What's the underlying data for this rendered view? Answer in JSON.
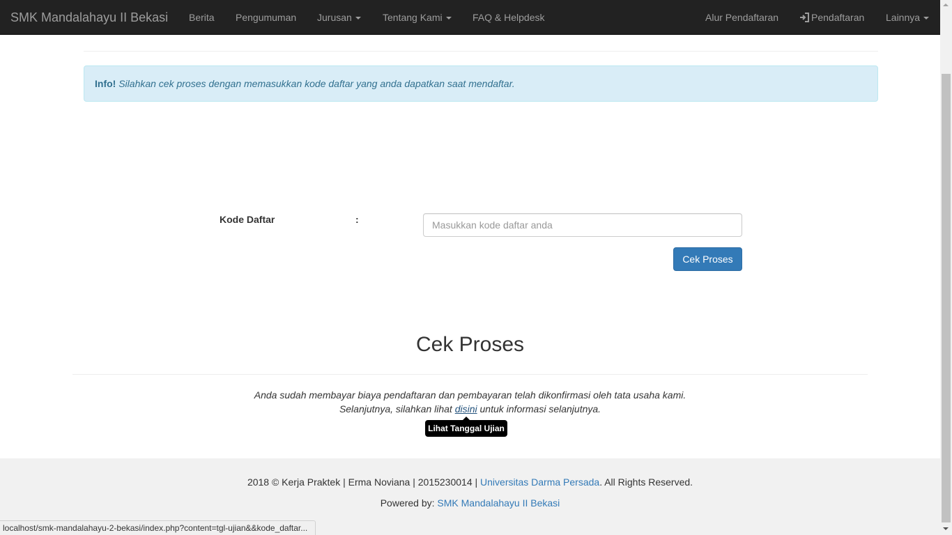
{
  "navbar": {
    "brand": "SMK Mandalahayu II Bekasi",
    "items": [
      {
        "label": "Berita"
      },
      {
        "label": "Pengumuman"
      },
      {
        "label": "Jurusan"
      },
      {
        "label": "Tentang Kami"
      },
      {
        "label": "FAQ & Helpdesk"
      }
    ],
    "right_items": [
      {
        "label": "Alur Pendaftaran"
      },
      {
        "label": "Pendaftaran",
        "icon": "login-icon"
      },
      {
        "label": "Lainnya"
      }
    ]
  },
  "alert": {
    "title": "Info!",
    "text": "Silahkan cek proses dengan memasukkan kode daftar yang anda dapatkan saat mendaftar."
  },
  "form": {
    "label": "Kode Daftar",
    "colon": ":",
    "placeholder": "Masukkan kode daftar anda",
    "value": "",
    "submit_label": "Cek Proses"
  },
  "result": {
    "title": "Cek Proses",
    "line1": "Anda sudah membayar biaya pendaftaran dan pembayaran telah dikonfirmasi oleh tata usaha kami.",
    "line2_before": "Selanjutnya, silahkan lihat ",
    "line2_link": "disini",
    "line2_after": " untuk informasi selanjutnya.",
    "tooltip": "Lihat Tanggal Ujian"
  },
  "footer": {
    "line1_text": "2018 © Kerja Praktek | Erma Noviana | 2015230014 | ",
    "line1_link": "Universitas Darma Persada",
    "line1_suffix": ". All Rights Reserved.",
    "line2_text": "Powered by: ",
    "line2_link": "SMK Mandalahayu II Bekasi"
  },
  "status_bar": {
    "url": "localhost/smk-mandalahayu-2-bekasi/index.php?content=tgl-ujian&&kode_daftar..."
  },
  "colors": {
    "navbar_bg": "#222222",
    "nav_text": "#9d9d9d",
    "alert_bg": "#d9edf7",
    "alert_text": "#31708f",
    "primary": "#337ab7",
    "footer_bg": "#f1f1f1"
  }
}
